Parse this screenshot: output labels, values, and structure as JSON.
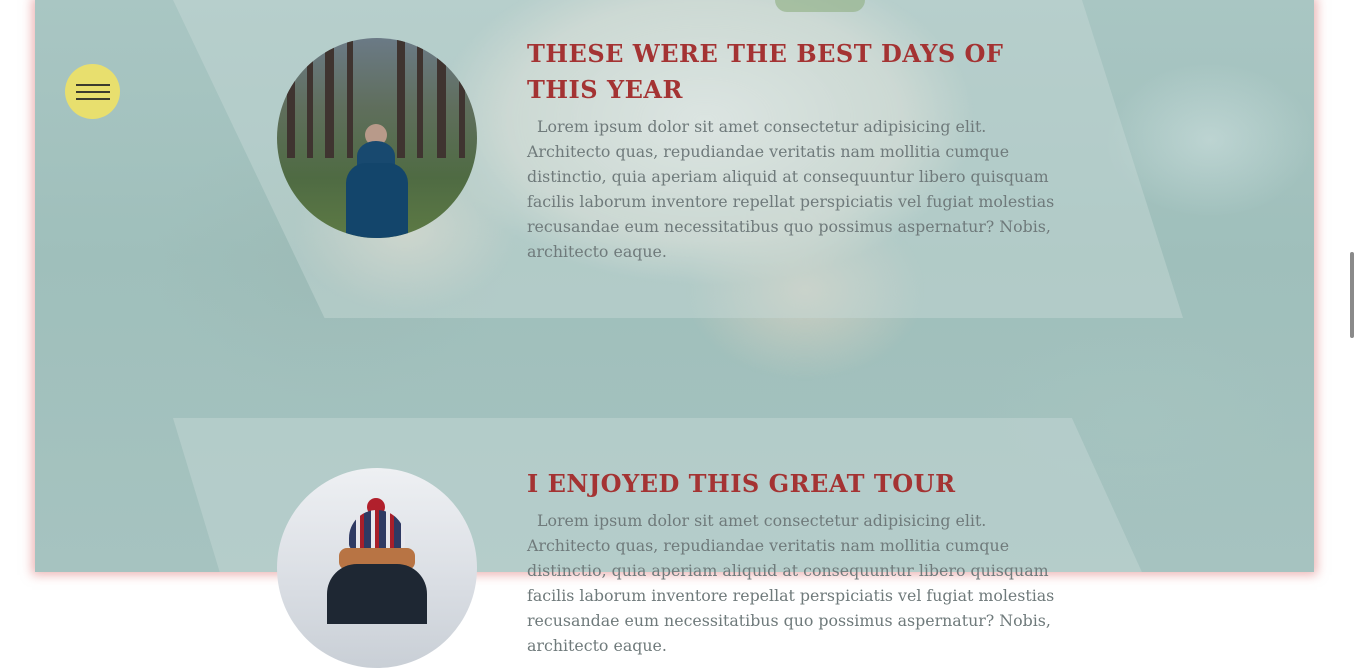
{
  "menu": {
    "icon": "hamburger-menu-icon",
    "color": "#e8df6e"
  },
  "articles": [
    {
      "title": "THESE WERE THE BEST DAYS OF THIS YEAR",
      "body": "Lorem ipsum dolor sit amet consectetur adipisicing elit. Architecto quas, repudiandae veritatis nam mollitia cumque distinctio, quia aperiam aliquid at consequuntur libero quisquam facilis laborum inventore repellat perspiciatis vel fugiat molestias recusandae eum necessitatibus quo possimus aspernatur? Nobis, architecto eaque."
    },
    {
      "title": "I ENJOYED THIS GREAT TOUR",
      "body": "Lorem ipsum dolor sit amet consectetur adipisicing elit. Architecto quas, repudiandae veritatis nam mollitia cumque distinctio, quia aperiam aliquid at consequuntur libero quisquam facilis laborum inventore repellat perspiciatis vel fugiat molestias recusandae eum necessitatibus quo possimus aspernatur? Nobis, architecto eaque."
    }
  ],
  "colors": {
    "title": "#a43333",
    "body": "#6f7a7b",
    "frame_border": "#dc7878",
    "panel": "#c8dad8"
  }
}
